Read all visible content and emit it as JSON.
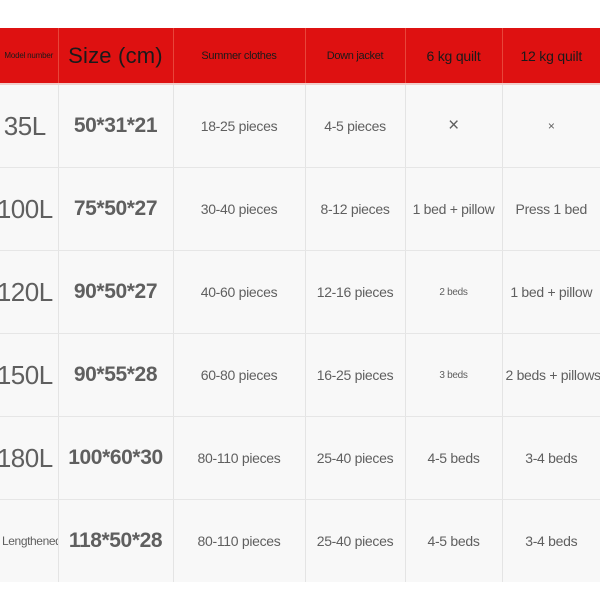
{
  "table": {
    "headers": [
      {
        "key": "model",
        "label": "Model number"
      },
      {
        "key": "size",
        "label": "Size (cm)"
      },
      {
        "key": "summer",
        "label": "Summer clothes"
      },
      {
        "key": "down",
        "label": "Down jacket"
      },
      {
        "key": "quilt6",
        "label": "6 kg quilt"
      },
      {
        "key": "quilt12",
        "label": "12 kg quilt"
      }
    ],
    "header_bg": "#de1111",
    "header_text_color": "#1a1a1a",
    "cell_bg": "#f8f8f8",
    "rows": [
      {
        "model": "35L",
        "size": "50*31*21",
        "summer": "18-25 pieces",
        "down": "4-5 pieces",
        "quilt6": "×",
        "quilt12": "×"
      },
      {
        "model": "100L",
        "size": "75*50*27",
        "summer": "30-40 pieces",
        "down": "8-12 pieces",
        "quilt6": "1 bed + pillow",
        "quilt12": "Press 1 bed"
      },
      {
        "model": "120L",
        "size": "90*50*27",
        "summer": "40-60 pieces",
        "down": "12-16 pieces",
        "quilt6": "2 beds",
        "quilt12": "1 bed + pillow"
      },
      {
        "model": "150L",
        "size": "90*55*28",
        "summer": "60-80 pieces",
        "down": "16-25 pieces",
        "quilt6": "3 beds",
        "quilt12": "2 beds + pillows"
      },
      {
        "model": "180L",
        "size": "100*60*30",
        "summer": "80-110 pieces",
        "down": "25-40 pieces",
        "quilt6": "4-5 beds",
        "quilt12": "3-4 beds"
      },
      {
        "model": "Lengthened",
        "size": "118*50*28",
        "summer": "80-110 pieces",
        "down": "25-40 pieces",
        "quilt6": "4-5 beds",
        "quilt12": "3-4 beds"
      }
    ]
  }
}
